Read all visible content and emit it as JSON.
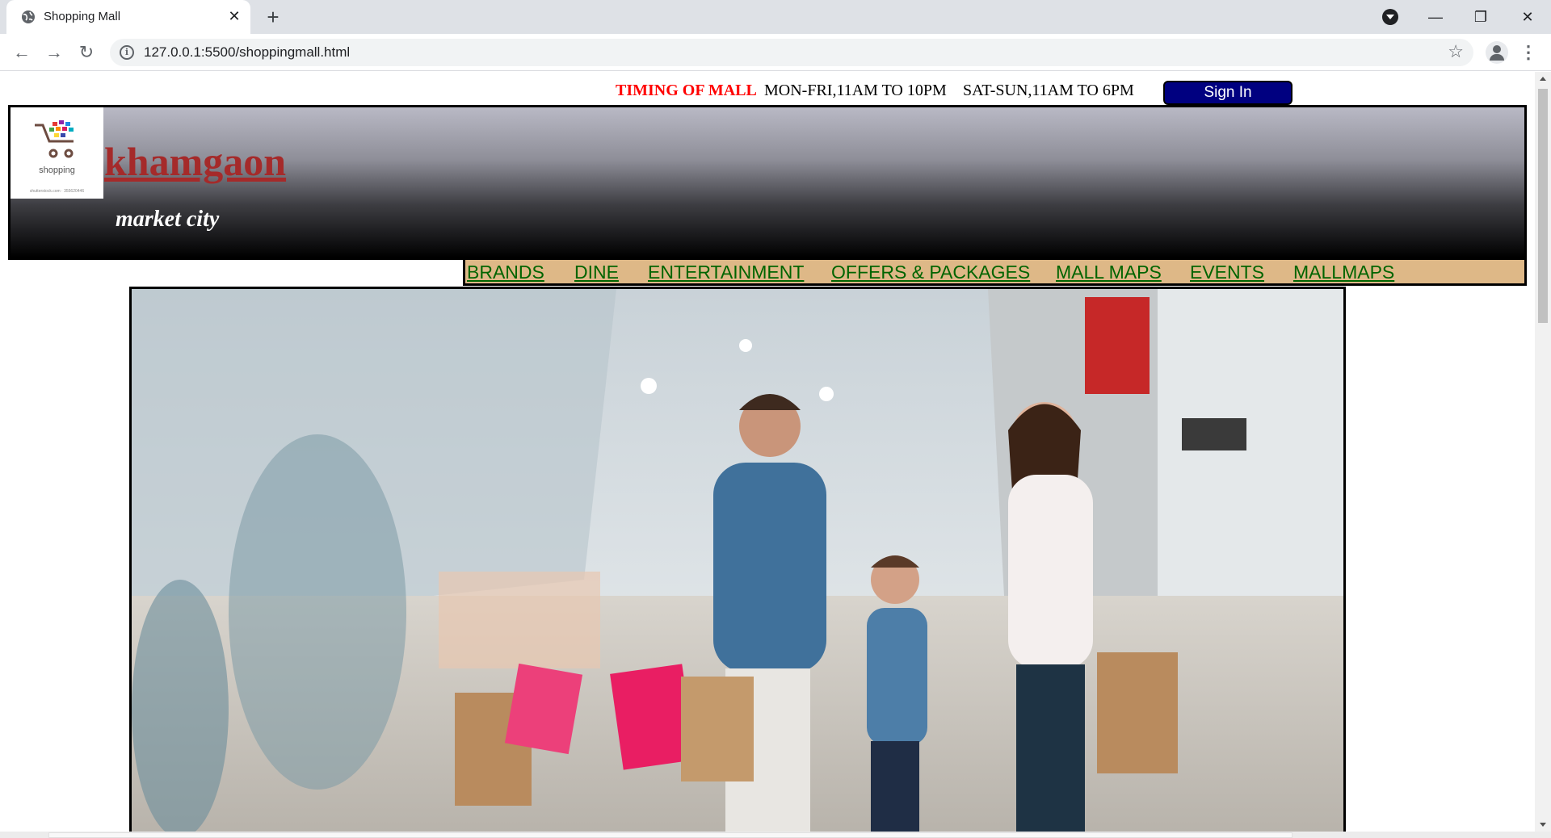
{
  "browser": {
    "tab_title": "Shopping Mall",
    "url": "127.0.0.1:5500/shoppingmall.html"
  },
  "timing": {
    "label": "TIMING OF MALL",
    "weekday": "MON-FRI,11AM TO 10PM",
    "weekend": "SAT-SUN,11AM TO 6PM"
  },
  "signin_label": "Sign In",
  "header": {
    "logo_text": "shopping",
    "logo_small": "shutterstock.com · 355620446",
    "site_name": "khamgaon",
    "tagline": "market city"
  },
  "nav": {
    "items": [
      "BRANDS",
      "DINE",
      "ENTERTAINMENT",
      "OFFERS & PACKAGES",
      "MALL MAPS",
      "EVENTS",
      "MALLMAPS"
    ]
  },
  "colors": {
    "timing_label": "#ff0000",
    "signin_bg": "#000080",
    "site_name": "#a52a2a",
    "nav_bg": "#deb887",
    "nav_link": "#006400"
  },
  "icons": {
    "back": "arrow-left",
    "forward": "arrow-right",
    "reload": "reload",
    "site_info": "info",
    "bookmark": "star",
    "account": "person",
    "menu": "kebab"
  }
}
